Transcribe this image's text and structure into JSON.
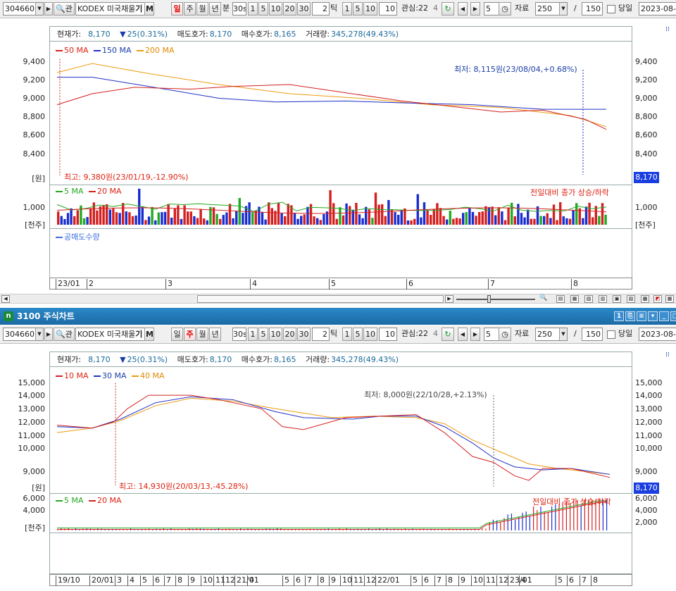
{
  "toolbar": {
    "code": "304660",
    "name": "KODEX 미국채울",
    "name_suffix": "기",
    "m": "M",
    "period": [
      "일",
      "주",
      "월",
      "년"
    ],
    "bun": "분",
    "min_val": "30s",
    "min_btns": [
      "1",
      "5",
      "10",
      "20",
      "30"
    ],
    "tick_val": "2",
    "tick_lbl": "틱",
    "tick_btns": [
      "1",
      "5",
      "10"
    ],
    "tick_input": "10",
    "interest": "관심:22",
    "interest_tail": "4",
    "count": "5",
    "jaryo": "자료",
    "jaryo_val": "250",
    "slash": "/",
    "total": "150",
    "dangil": "당일",
    "date": "2023-08-"
  },
  "window": {
    "title": "3100 주식차트",
    "icon": "n"
  },
  "top": {
    "info": {
      "price_lbl": "현재가:",
      "price": "8,170",
      "arrow": "▼",
      "change": "25(0.31%)",
      "ask_lbl": "매도호가:",
      "ask": "8,170",
      "bid_lbl": "매수호가:",
      "bid": "8,165",
      "vol_lbl": "거래량:",
      "vol": "345,278(49.43%)"
    },
    "legend": [
      "50 MA",
      "150 MA",
      "200 MA"
    ],
    "legend_colors": [
      "#d42020",
      "#2030c8",
      "#ee9a10"
    ],
    "y_ticks": [
      "9,400",
      "9,200",
      "9,000",
      "8,800",
      "8,600",
      "8,400"
    ],
    "unit": "[원]",
    "price_tag": "8,170",
    "low_ann": "최저: 8,115원(23/08/04,+0.68%)",
    "high_ann": "최고: 9,380원(23/01/19,-12.90%)",
    "vol_legend": [
      "5 MA",
      "20 MA"
    ],
    "vol_legend_colors": [
      "#22aa22",
      "#d42020"
    ],
    "vol_note": "전일대비 종가 상승/하락",
    "vol_tick": "1,000",
    "vol_unit": "[천주]",
    "short_legend": "공매도수량",
    "x_labels": [
      "23/01",
      "2",
      "3",
      "4",
      "5",
      "6",
      "7",
      "8"
    ],
    "chart_data": {
      "type": "candlestick",
      "title": "",
      "y_range": [
        8100,
        9420
      ],
      "series": [
        "50 MA",
        "150 MA",
        "200 MA"
      ],
      "high": {
        "value": 9380,
        "date": "23/01/19"
      },
      "low": {
        "value": 8115,
        "date": "23/08/04"
      },
      "last": 8170
    }
  },
  "bottom": {
    "info": {
      "price_lbl": "현재가:",
      "price": "8,170",
      "arrow": "▼",
      "change": "25(0.31%)",
      "ask_lbl": "매도호가:",
      "ask": "8,170",
      "bid_lbl": "매수호가:",
      "bid": "8,165",
      "vol_lbl": "거래량:",
      "vol": "345,278(49.43%)"
    },
    "legend": [
      "10 MA",
      "30 MA",
      "40 MA"
    ],
    "legend_colors": [
      "#d42020",
      "#2030c8",
      "#ee9a10"
    ],
    "y_ticks": [
      "15,000",
      "14,000",
      "13,000",
      "12,000",
      "11,000",
      "10,000",
      "9,000"
    ],
    "unit": "[원]",
    "price_tag": "8,170",
    "low_ann": "최저: 8,000원(22/10/28,+2.13%)",
    "high_ann": "최고: 14,930원(20/03/13,-45.28%)",
    "vol_legend": [
      "5 MA",
      "20 MA"
    ],
    "vol_legend_colors": [
      "#22aa22",
      "#d42020"
    ],
    "vol_note": "전일대비 종가 상승/하락",
    "vol_ticks": [
      "6,000",
      "4,000",
      "2,000"
    ],
    "vol_unit": "[천주]",
    "x_labels": [
      "19/10",
      "20/01",
      "3",
      "4",
      "5",
      "6",
      "7",
      "8",
      "9",
      "10",
      "11",
      "12",
      "21/01",
      "4",
      "5",
      "6",
      "7",
      "8",
      "9",
      "10",
      "11",
      "12",
      "22/01",
      "5",
      "6",
      "7",
      "8",
      "9",
      "10",
      "11",
      "12",
      "23/01",
      "4",
      "5",
      "6",
      "7",
      "8"
    ],
    "chart_data": {
      "type": "candlestick",
      "title": "",
      "y_range": [
        8000,
        15300
      ],
      "series": [
        "10 MA",
        "30 MA",
        "40 MA"
      ],
      "high": {
        "value": 14930,
        "date": "20/03/13"
      },
      "low": {
        "value": 8000,
        "date": "22/10/28"
      },
      "last": 8170
    }
  }
}
